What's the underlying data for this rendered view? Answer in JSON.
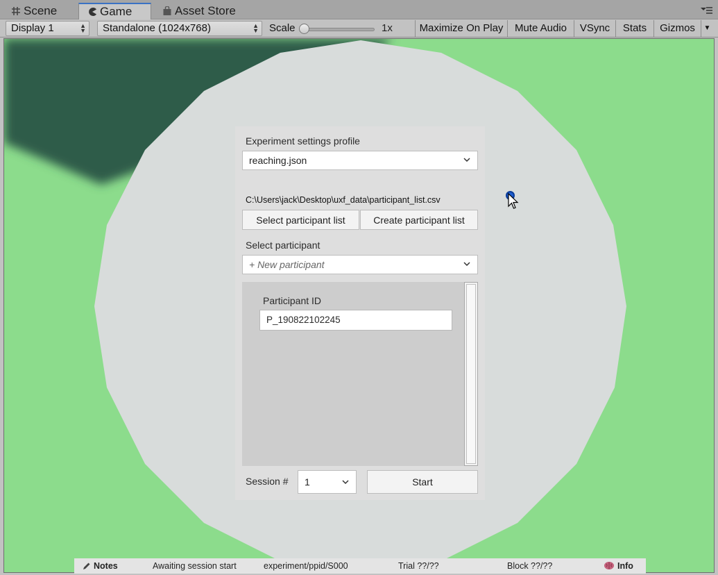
{
  "tabs": [
    {
      "label": "Scene",
      "icon": "grid-hash-icon"
    },
    {
      "label": "Game",
      "icon": "pacman-icon"
    },
    {
      "label": "Asset Store",
      "icon": "shopping-bag-icon"
    }
  ],
  "toolbar": {
    "display": "Display 1",
    "resolution": "Standalone (1024x768)",
    "scale_label": "Scale",
    "scale_value": "1x",
    "scale_level": 0,
    "maximize_on_play": "Maximize On Play",
    "mute_audio": "Mute Audio",
    "vsync": "VSync",
    "stats": "Stats",
    "gizmos": "Gizmos"
  },
  "panel": {
    "profile_label": "Experiment settings profile",
    "profile_value": "reaching.json",
    "participant_list_path": "C:\\Users\\jack\\Desktop\\uxf_data\\participant_list.csv",
    "select_list_button": "Select participant list",
    "create_list_button": "Create participant list",
    "select_participant_label": "Select participant",
    "participant_dropdown_value": "+ New participant",
    "participant_id_label": "Participant ID",
    "participant_id_value": "P_190822102245",
    "session_label": "Session #",
    "session_value": "1",
    "start_button": "Start"
  },
  "statusbar": {
    "notes": "Notes",
    "status": "Awaiting session start",
    "path": "experiment/ppid/S000",
    "trial": "Trial ??/??",
    "block": "Block ??/??",
    "info": "Info"
  },
  "colors": {
    "ground": "#8cdc8c",
    "shadow": "#2e5c4a",
    "disc": "#d8dcdb",
    "panel": "#dedede",
    "tab_accent": "#3a72c4",
    "cursor_dot": "#1f5fcf"
  }
}
